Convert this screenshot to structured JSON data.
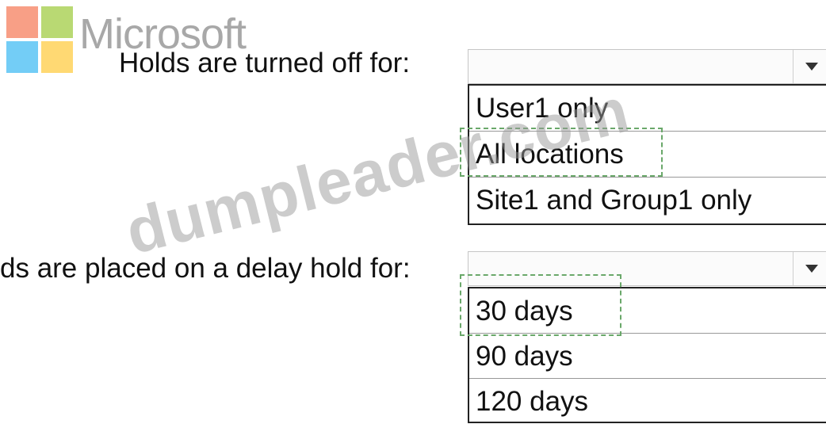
{
  "logo": {
    "wordmark": "Microsoft",
    "colors": [
      "#f25022",
      "#7fba00",
      "#00a4ef",
      "#ffb900"
    ]
  },
  "watermark": "dumpleader.com",
  "questions": [
    {
      "label": "Holds are turned off for:",
      "selected": "",
      "options": [
        "User1 only",
        "All locations",
        "Site1 and Group1 only"
      ],
      "answer": "All locations"
    },
    {
      "label": "ds are placed on a delay hold for:",
      "selected": "",
      "options": [
        "30 days",
        "90 days",
        "120 days"
      ],
      "answer": "30 days"
    }
  ],
  "colors": {
    "answer_highlight": "#6aa86a",
    "list_border": "#222222"
  }
}
